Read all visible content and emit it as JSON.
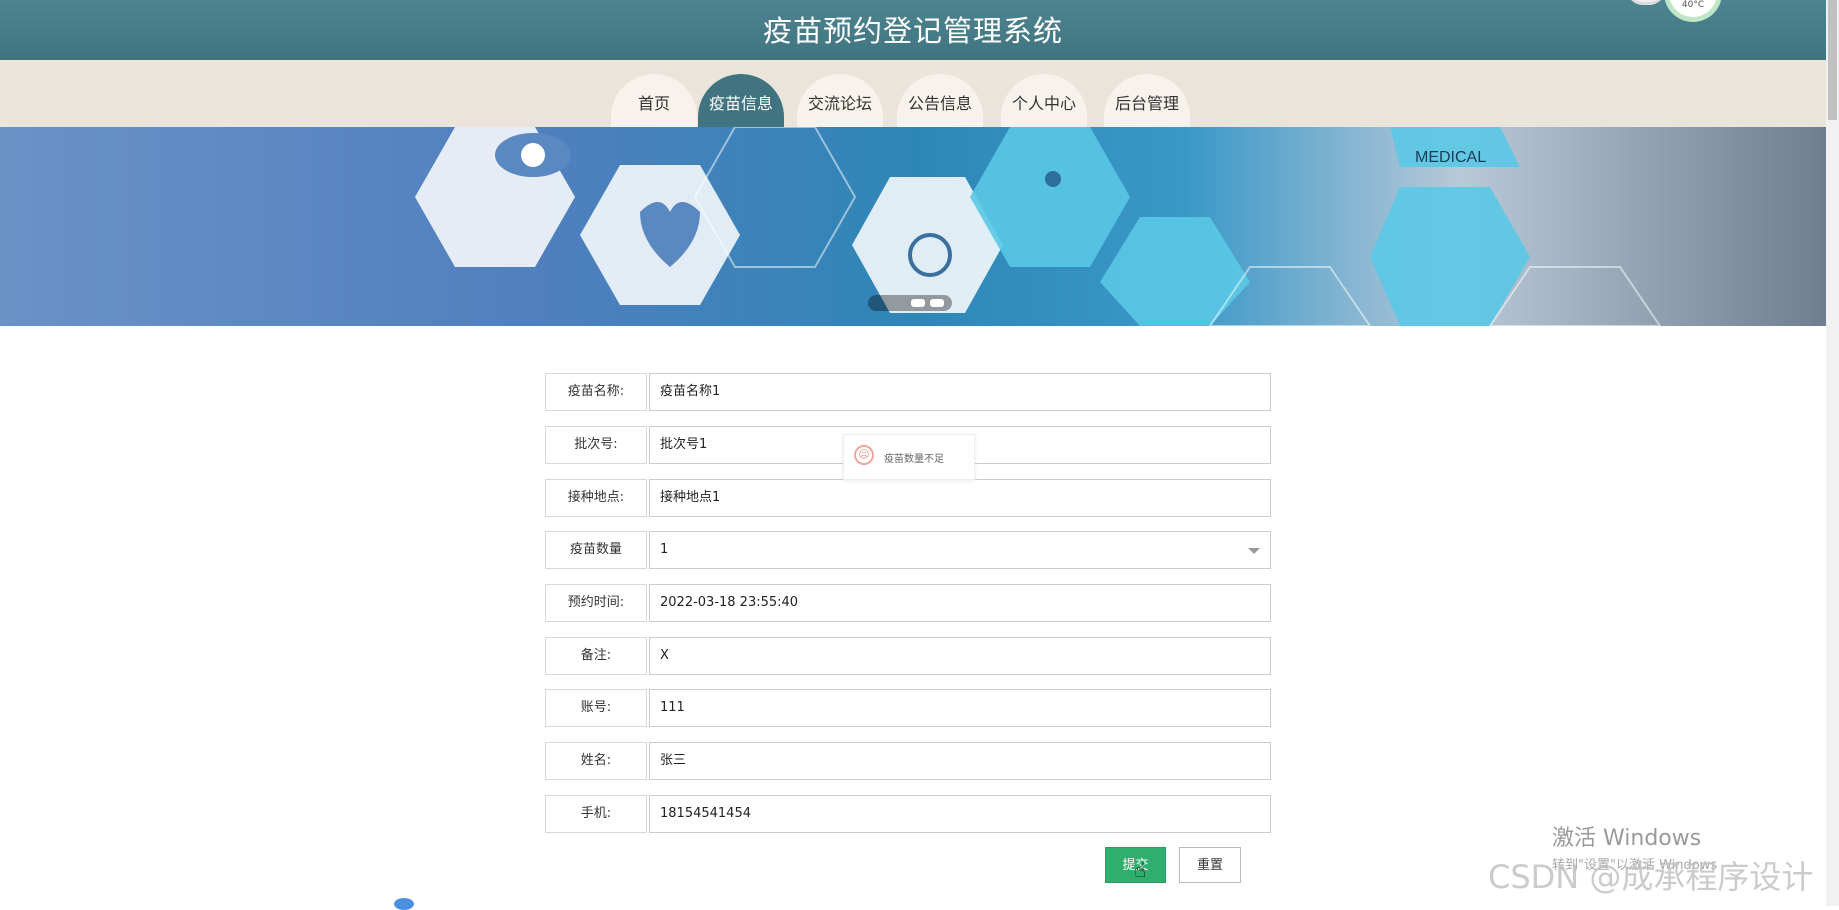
{
  "header": {
    "title": "疫苗预约登记管理系统",
    "weather_temp": "40°C"
  },
  "nav": {
    "items": [
      {
        "label": "首页"
      },
      {
        "label": "疫苗信息"
      },
      {
        "label": "交流论坛"
      },
      {
        "label": "公告信息"
      },
      {
        "label": "个人中心"
      },
      {
        "label": "后台管理"
      }
    ],
    "active_index": 1
  },
  "banner": {
    "text": "MEDICAL"
  },
  "form": {
    "fields": [
      {
        "label": "疫苗名称:",
        "value": "疫苗名称1"
      },
      {
        "label": "批次号:",
        "value": "批次号1"
      },
      {
        "label": "接种地点:",
        "value": "接种地点1"
      },
      {
        "label": "疫苗数量",
        "value": "1"
      },
      {
        "label": "预约时间:",
        "value": "2022-03-18 23:55:40"
      },
      {
        "label": "备注:",
        "value": "X"
      },
      {
        "label": "账号:",
        "value": "111"
      },
      {
        "label": "姓名:",
        "value": "张三"
      },
      {
        "label": "手机:",
        "value": "18154541454"
      }
    ],
    "submit_label": "提交",
    "reset_label": "重置"
  },
  "toast": {
    "message": "疫苗数量不足"
  },
  "watermarks": {
    "windows_line1": "激活 Windows",
    "windows_line2": "转到\"设置\"以激活 Windows",
    "csdn": "CSDN @成承程序设计"
  },
  "colors": {
    "header": "#3f7480",
    "nav_bg": "#ebe4da",
    "submit": "#2fae6d"
  }
}
